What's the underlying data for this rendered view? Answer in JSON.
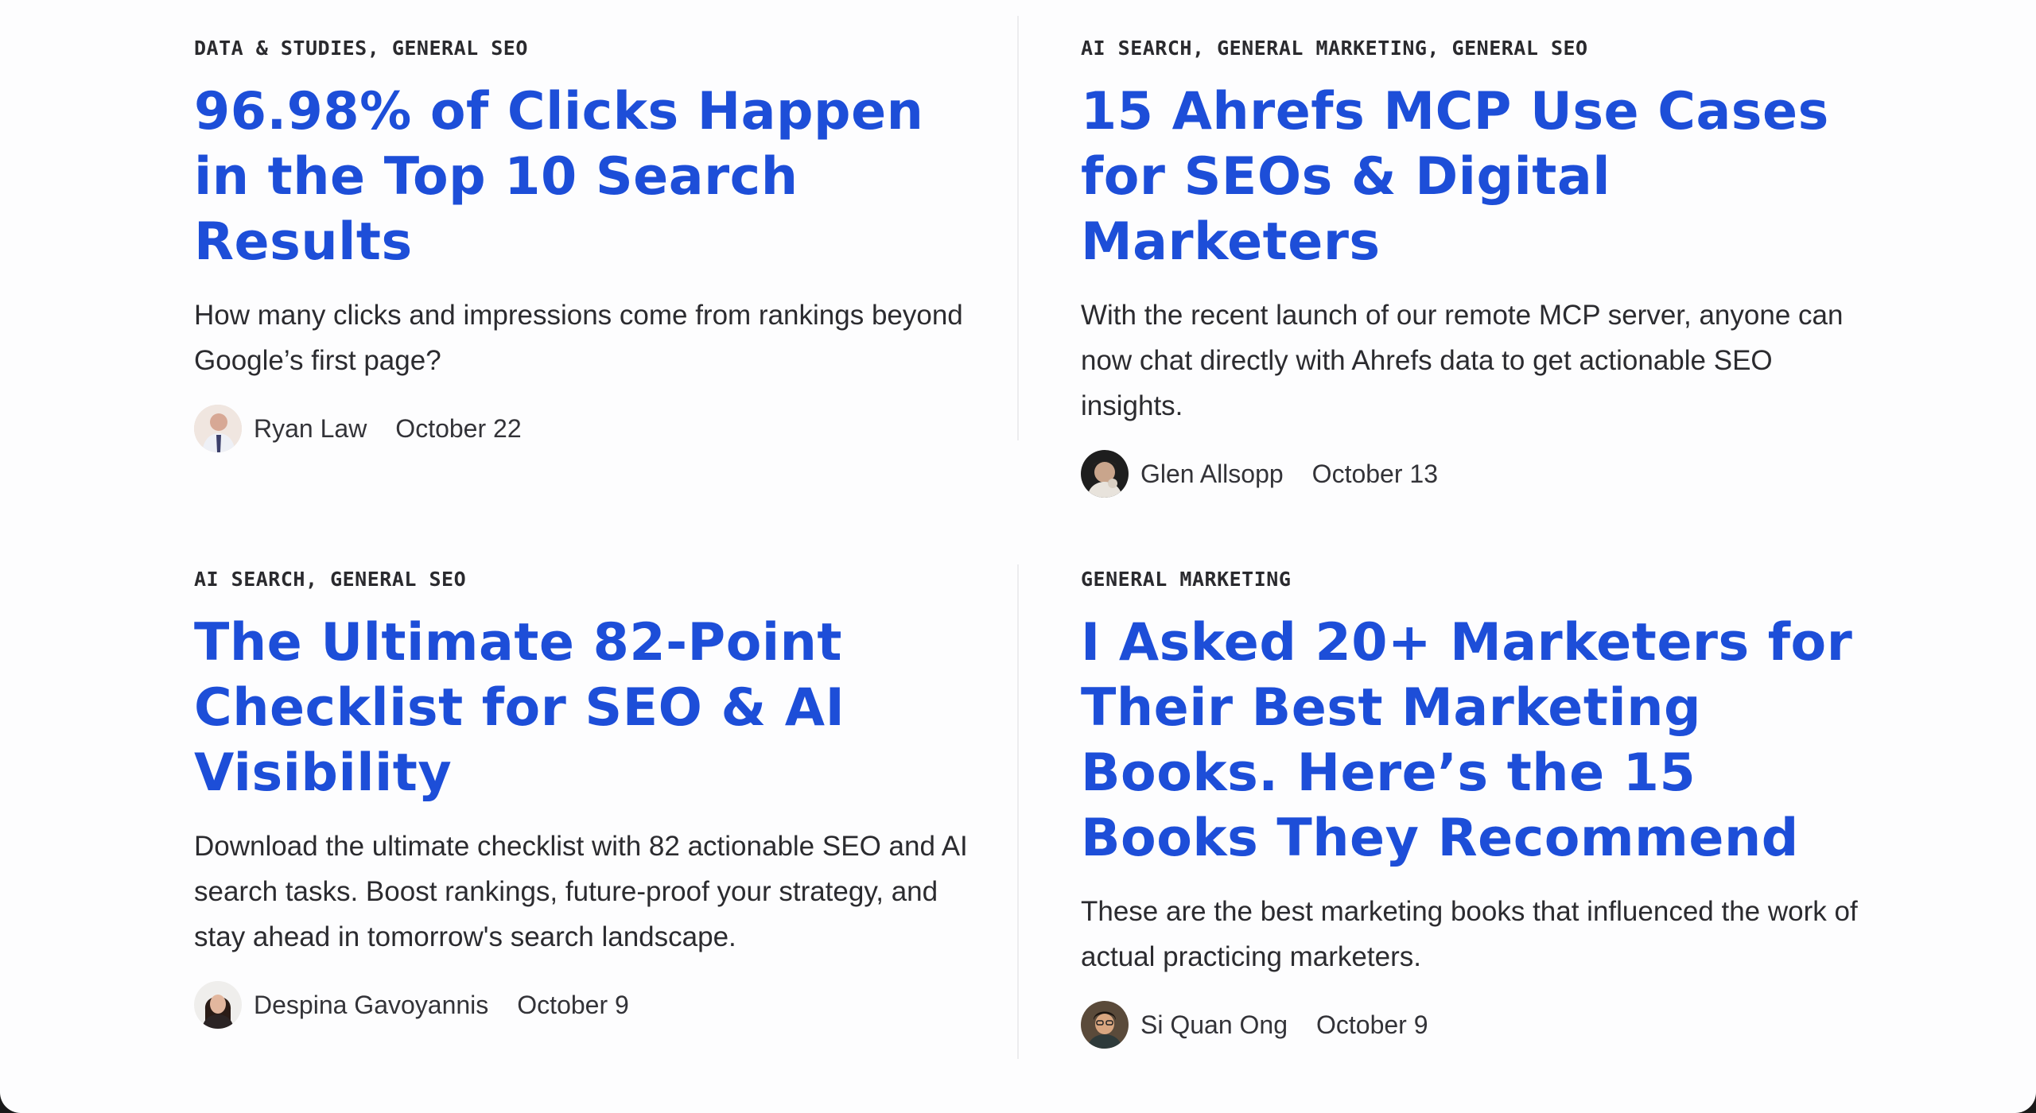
{
  "posts": [
    {
      "categories": "DATA & STUDIES, GENERAL SEO",
      "title": "96.98% of Clicks Happen in the Top 10 Search Results",
      "excerpt": "How many clicks and impressions come from rankings beyond Google’s first page?",
      "author": "Ryan Law",
      "date": "October 22"
    },
    {
      "categories": "AI SEARCH, GENERAL MARKETING, GENERAL SEO",
      "title": "15 Ahrefs MCP Use Cases for SEOs & Digital Marketers",
      "excerpt": "With the recent launch of our remote MCP server, anyone can now chat directly with Ahrefs data to get actionable SEO insights.",
      "author": "Glen Allsopp",
      "date": "October 13"
    },
    {
      "categories": "AI SEARCH, GENERAL SEO",
      "title": "The Ultimate 82-Point Checklist for SEO & AI Visibility",
      "excerpt": "Download the ultimate checklist with 82 actionable SEO and AI search tasks. Boost rankings, future-proof your strategy, and stay ahead in tomorrow's search landscape.",
      "author": "Despina Gavoyannis",
      "date": "October 9"
    },
    {
      "categories": "GENERAL MARKETING",
      "title": "I Asked 20+ Marketers for Their Best Marketing Books. Here’s the 15 Books They Recommend",
      "excerpt": "These are the best marketing books that influenced the work of actual practicing marketers.",
      "author": "Si Quan Ong",
      "date": "October 9"
    }
  ],
  "colors": {
    "title": "#1d4ed8",
    "text": "#2b2b2f",
    "background": "#fdfdfe",
    "divider": "#ececef"
  }
}
